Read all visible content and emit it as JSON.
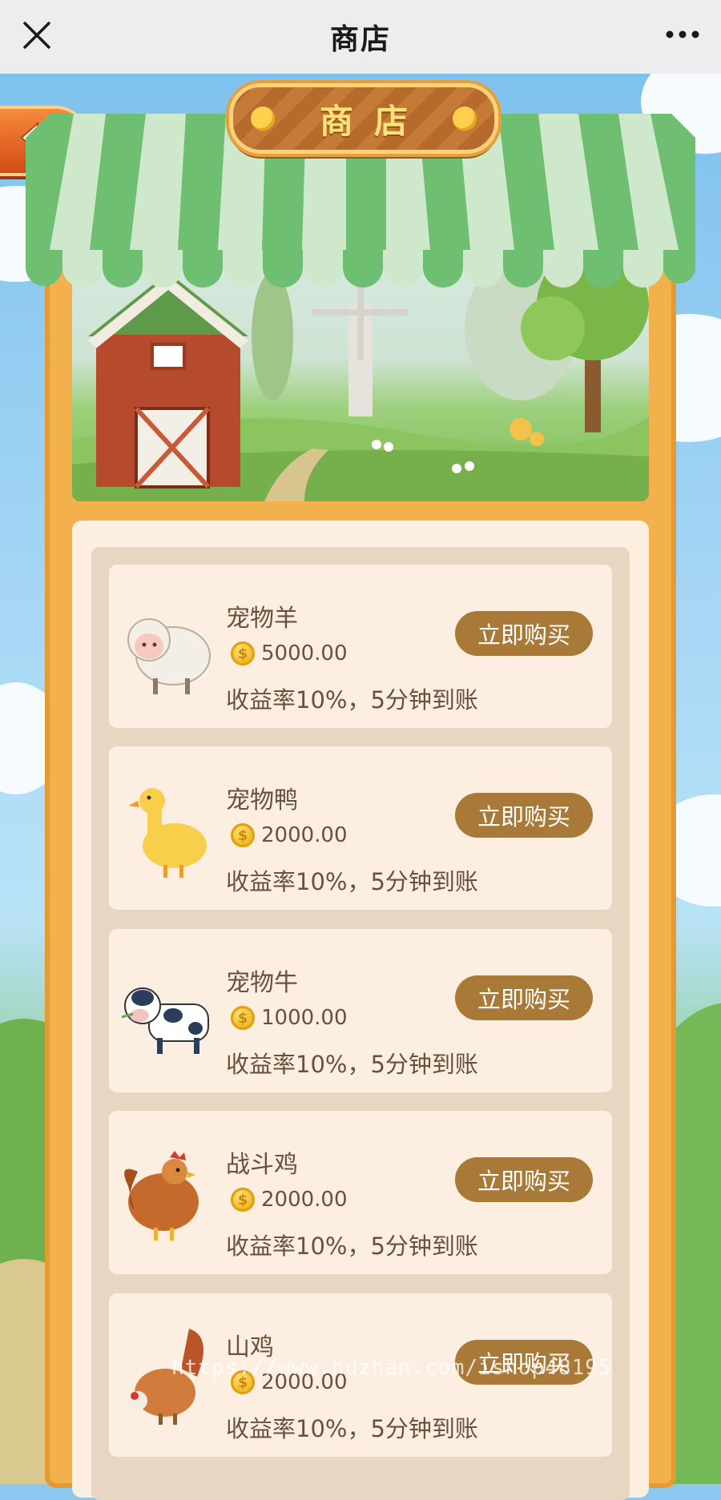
{
  "topbar": {
    "title": "商店",
    "close_icon": "close-icon",
    "more_icon": "more-dots-icon"
  },
  "shop": {
    "sign_label": "商店",
    "back_icon": "back-arrow-icon"
  },
  "items": [
    {
      "name": "宠物羊",
      "price": "5000.00",
      "rate": "收益率10%，5分钟到账",
      "button": "立即购买",
      "icon": "sheep-icon"
    },
    {
      "name": "宠物鸭",
      "price": "2000.00",
      "rate": "收益率10%，5分钟到账",
      "button": "立即购买",
      "icon": "duck-icon"
    },
    {
      "name": "宠物牛",
      "price": "1000.00",
      "rate": "收益率10%，5分钟到账",
      "button": "立即购买",
      "icon": "cow-icon"
    },
    {
      "name": "战斗鸡",
      "price": "2000.00",
      "rate": "收益率10%，5分钟到账",
      "button": "立即购买",
      "icon": "rooster-icon"
    },
    {
      "name": "山鸡",
      "price": "2000.00",
      "rate": "收益率10%，5分钟到账",
      "button": "立即购买",
      "icon": "pheasant-icon"
    }
  ],
  "watermark": "https://www.huzhan.com/ishop48195",
  "colors": {
    "button": "#a97a37",
    "board": "#f2b14c",
    "awning_green": "#6fbf73",
    "card_bg": "#fcefe2",
    "text": "#6a4f3b"
  }
}
